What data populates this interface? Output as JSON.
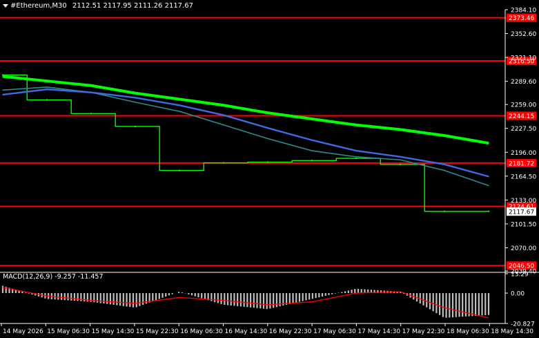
{
  "header": {
    "symbol": "#Ethereum,M30",
    "open": "2112.51",
    "high": "2117.95",
    "low": "2111.26",
    "close": "2117.67"
  },
  "macd": {
    "label": "MACD(12,26,9)",
    "main": "-9.257",
    "signal": "-11.457",
    "axis_labels": [
      "13.29",
      "0.00",
      "-20.827"
    ]
  },
  "price_axis": {
    "ticks": [
      "2384.10",
      "2352.60",
      "2321.10",
      "2289.60",
      "2259.00",
      "2227.50",
      "2196.00",
      "2164.50",
      "2133.00",
      "2101.50",
      "2070.00",
      "2039.40"
    ],
    "current_price": "2117.67"
  },
  "levels": [
    {
      "value": 2373.46,
      "label": "2373.46"
    },
    {
      "value": 2316.5,
      "label": "2316.50"
    },
    {
      "value": 2244.15,
      "label": "2244.15"
    },
    {
      "value": 2181.72,
      "label": "2181.72"
    },
    {
      "value": 2124.61,
      "label": "2124.61"
    },
    {
      "value": 2046.5,
      "label": "2046.50"
    }
  ],
  "time_axis": [
    "14 May 2026",
    "15 May 06:30",
    "15 May 14:30",
    "15 May 22:30",
    "16 May 06:30",
    "16 May 14:30",
    "16 May 22:30",
    "17 May 06:30",
    "17 May 14:30",
    "17 May 22:30",
    "18 May 06:30",
    "18 May 14:30"
  ],
  "colors": {
    "background": "#000000",
    "level_line": "#ff0000",
    "price_line": "#00ff00",
    "ma_fast": "#2e8b8b",
    "ma_mid": "#4169e1",
    "ma_slow": "#00ff00",
    "macd_hist": "#c0c0c0",
    "macd_signal": "#ff0000",
    "axis": "#ffffff"
  },
  "chart_data": {
    "type": "line",
    "title": "#Ethereum,M30",
    "ylim": [
      2039.4,
      2384.1
    ],
    "x": [
      "14 May 2026",
      "15 May 06:30",
      "15 May 14:30",
      "15 May 22:30",
      "16 May 06:30",
      "16 May 14:30",
      "16 May 22:30",
      "17 May 06:30",
      "17 May 14:30",
      "17 May 22:30",
      "18 May 06:30",
      "18 May 14:30"
    ],
    "series": [
      {
        "values": [
          2298,
          2265,
          2247,
          2230,
          2172,
          2182,
          2183,
          2185,
          2188,
          2180,
          2118,
          2118
        ]
      },
      {
        "values": [
          2278,
          2282,
          2275,
          2262,
          2250,
          2232,
          2214,
          2198,
          2190,
          2186,
          2172,
          2152
        ]
      },
      {
        "values": [
          2272,
          2279,
          2275,
          2268,
          2258,
          2245,
          2228,
          2212,
          2198,
          2190,
          2180,
          2164
        ]
      },
      {
        "values": [
          2296,
          2290,
          2284,
          2274,
          2266,
          2258,
          2248,
          2240,
          2232,
          2226,
          2218,
          2208
        ]
      }
    ],
    "macd_histogram": [
      5,
      -4,
      -6,
      -10,
      1,
      -8,
      -11,
      -4,
      3,
      1,
      -17,
      -15
    ],
    "macd_signal": [
      4,
      -2,
      -5,
      -7,
      -3,
      -5,
      -8,
      -6,
      0,
      1,
      -10,
      -17
    ]
  }
}
